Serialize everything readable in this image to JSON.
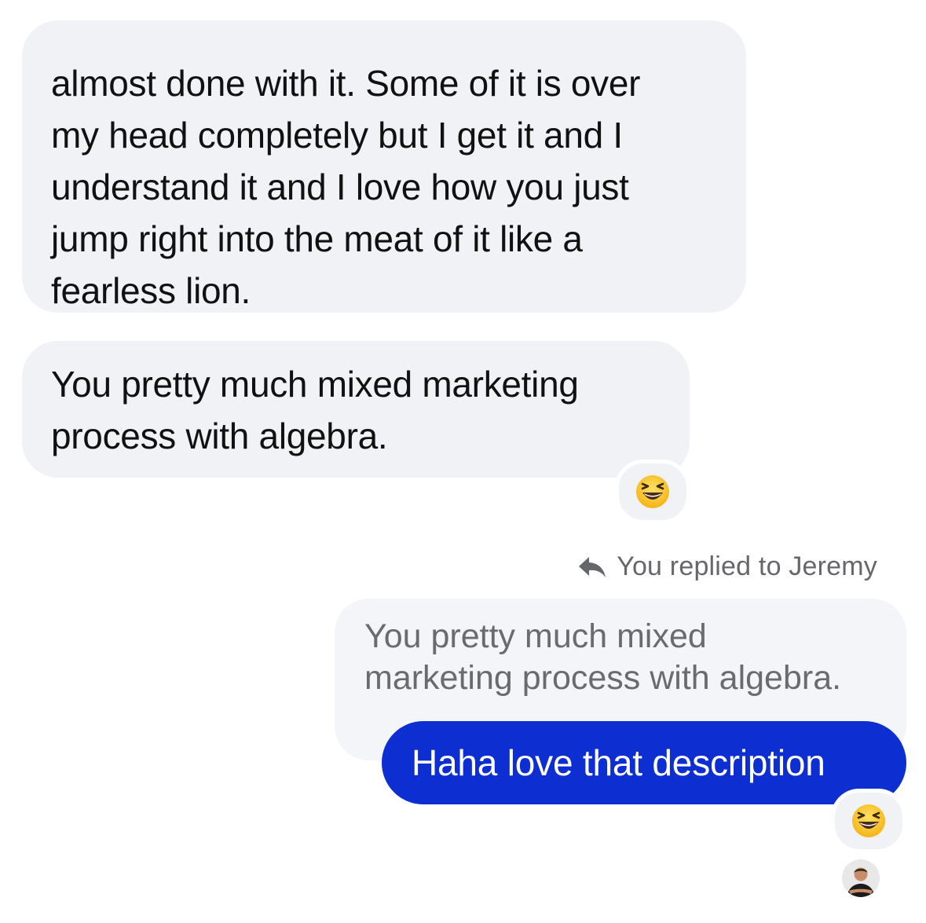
{
  "conversation": {
    "contact_name": "Jeremy",
    "messages": [
      {
        "direction": "incoming",
        "text_lines": [
          "almost done with it. Some of it is over",
          "my head completely but I get it and I",
          "understand it and I love how you just",
          "jump right into the meat of it like a",
          "fearless lion."
        ]
      },
      {
        "direction": "incoming",
        "text_lines": [
          "You pretty much mixed marketing",
          "process with algebra."
        ],
        "reaction": "grinning-squinting-face-emoji"
      }
    ],
    "reply": {
      "header_icon": "reply-arrow-icon",
      "header_text": "You replied to Jeremy",
      "quoted_lines": [
        "You pretty much mixed",
        "marketing process with algebra."
      ],
      "text": "Haha love that description",
      "reaction": "grinning-squinting-face-emoji"
    },
    "seen_avatar": "user-avatar"
  },
  "colors": {
    "incoming_bubble": "#f1f2f6",
    "outgoing_bubble": "#0d2ed1",
    "muted_text": "#65676b"
  }
}
